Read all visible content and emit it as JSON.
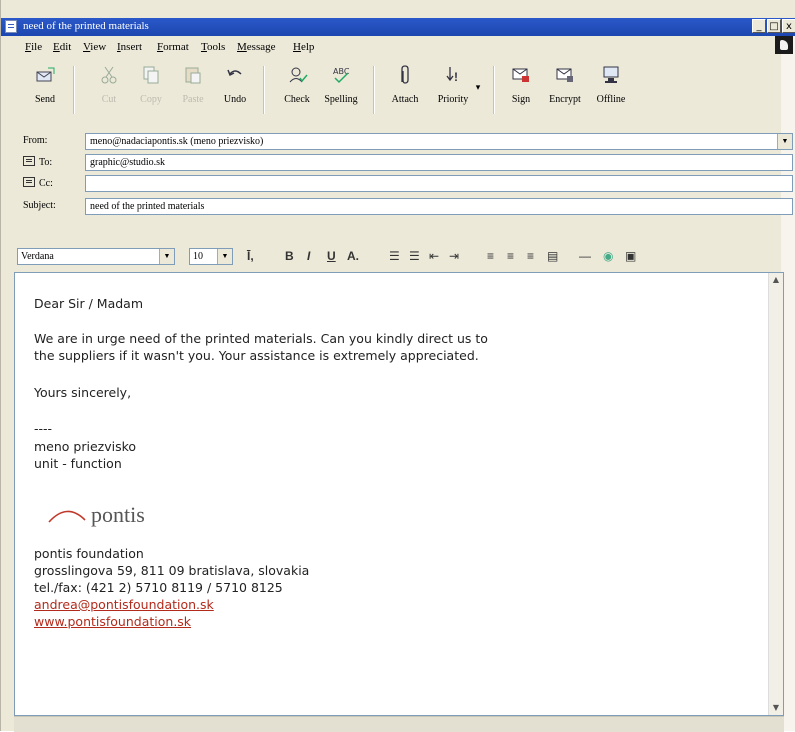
{
  "window": {
    "title": "need of the printed materials",
    "controls": [
      "_",
      "□",
      "x"
    ]
  },
  "menu": [
    "File",
    "Edit",
    "View",
    "Insert",
    "Format",
    "Tools",
    "Message",
    "Help"
  ],
  "toolbar": {
    "send": "Send",
    "cut": "Cut",
    "copy": "Copy",
    "paste": "Paste",
    "undo": "Undo",
    "check": "Check",
    "spelling": "Spelling",
    "attach": "Attach",
    "priority": "Priority",
    "sign": "Sign",
    "encrypt": "Encrypt",
    "offline": "Offline"
  },
  "header": {
    "from_label": "From:",
    "from_value": "meno@nadaciapontis.sk   (meno priezvisko)",
    "to_label": "To:",
    "to_value": "graphic@studio.sk",
    "cc_label": "Cc:",
    "cc_value": "",
    "subject_label": "Subject:",
    "subject_value": "need of the printed materials"
  },
  "format": {
    "font": "Verdana",
    "size": "10"
  },
  "body": {
    "greeting": "Dear Sir / Madam",
    "line1": "We are in urge need of the printed materials. Can you kindly direct us to",
    "line2": "the suppliers if it wasn't you. Your assistance is extremely appreciated.",
    "closing": "Yours sincerely,",
    "separator": "----",
    "sig_name": "meno priezvisko",
    "sig_role": "unit - function",
    "logo_text": "pontis",
    "org": "pontis foundation",
    "address": "grosslingova 59, 811 09 bratislava, slovakia",
    "phone": "tel./fax: (421 2) 5710 8119 / 5710 8125",
    "email": "andrea@pontisfoundation.sk",
    "web": "www.pontisfoundation.sk"
  },
  "colors": {
    "titlebar": "#2b59c9",
    "chrome": "#ece9d8",
    "link": "#b22a1b",
    "logo_arc": "#c0392b"
  }
}
